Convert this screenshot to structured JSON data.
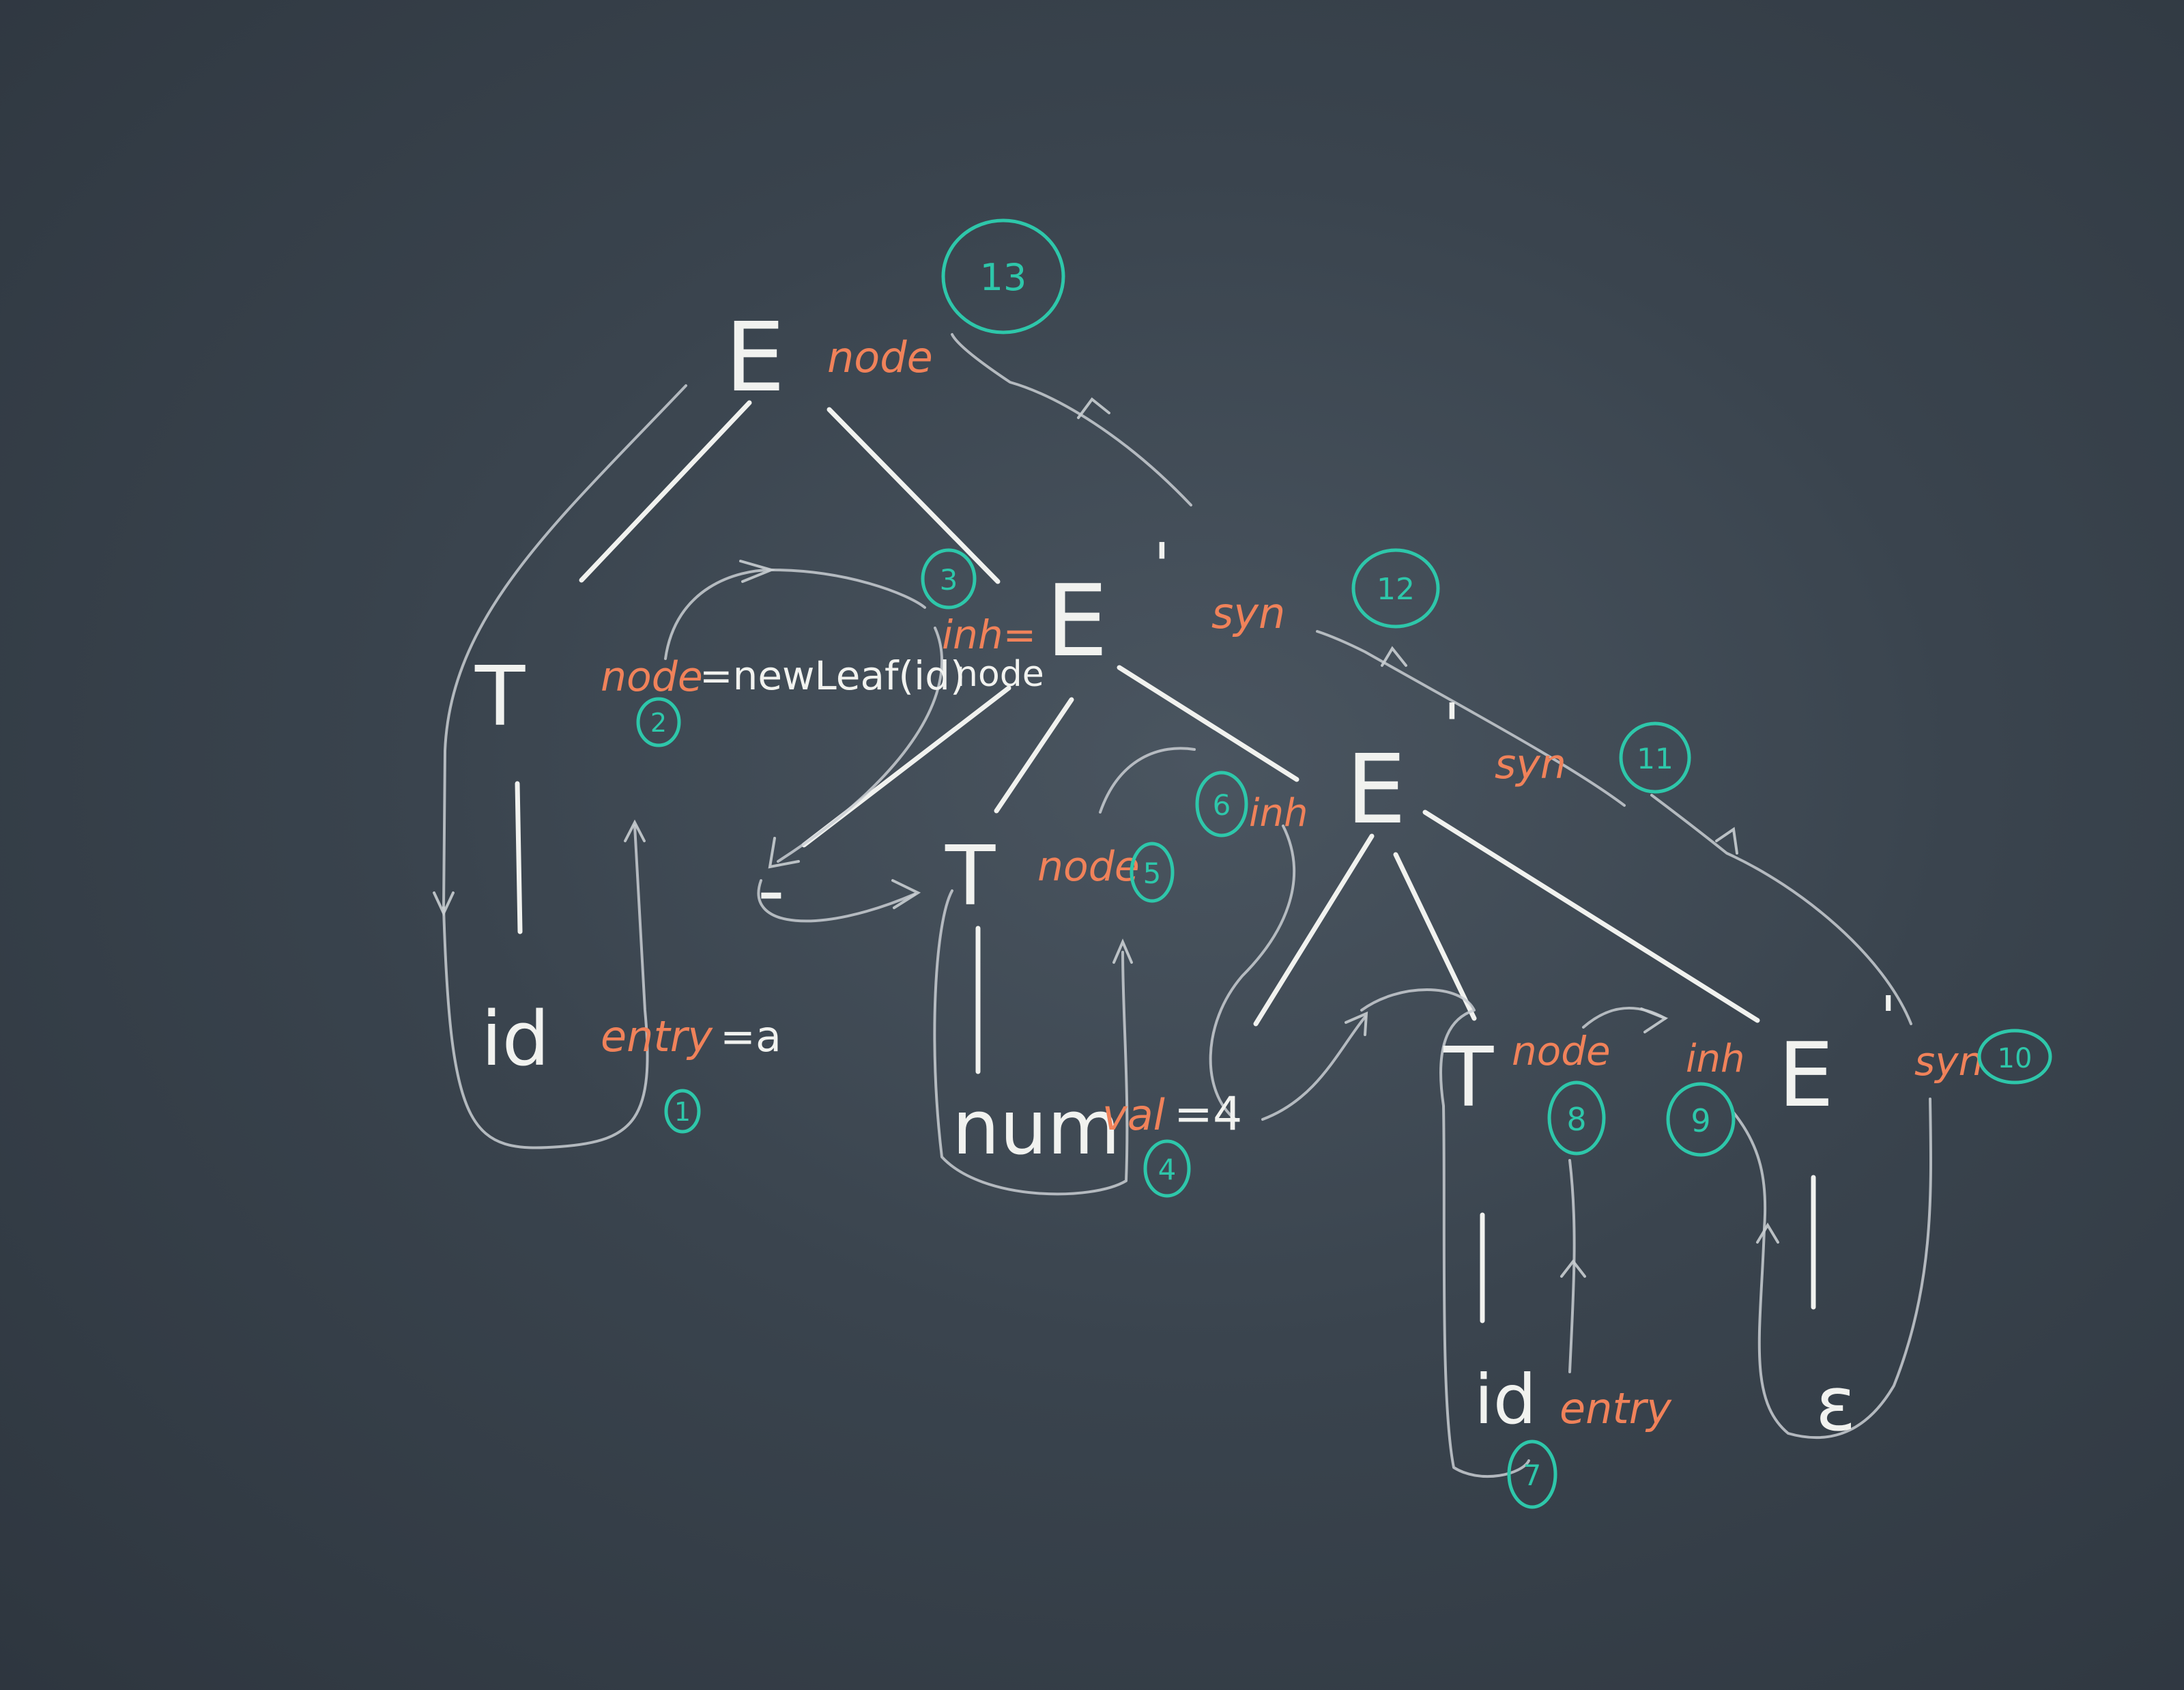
{
  "nodes": {
    "E_root": "E",
    "T_left": "T",
    "id_left": "id",
    "E_prime_1": "E",
    "minus": "-",
    "T_mid": "T",
    "num": "num",
    "E_prime_2": "E",
    "T_right": "T",
    "id_right": "id",
    "E_prime_3": "E",
    "epsilon": "ε"
  },
  "primes": {
    "p1": "'",
    "p2": "'",
    "p3": "'"
  },
  "attributes": {
    "root_node": "node",
    "t_left_node": "node",
    "newleaf_call": "=newLeaf(id)",
    "id_left_entry": "entry",
    "id_left_value": "=a",
    "e1_inh": "inh=",
    "e1_inh_node": "node",
    "e1_syn": "syn",
    "t_mid_node": "node",
    "num_val": "val",
    "num_val_value": "=4",
    "e2_inh": "inh",
    "e2_syn": "syn",
    "t_right_node": "node",
    "e3_inh": "inh",
    "e3_syn": "syn",
    "id_right_entry": "entry"
  },
  "steps": {
    "s1": "1",
    "s2": "2",
    "s3": "3",
    "s4": "4",
    "s5": "5",
    "s6": "6",
    "s7": "7",
    "s8": "8",
    "s9": "9",
    "s10": "10",
    "s11": "11",
    "s12": "12",
    "s13": "13"
  },
  "colors": {
    "board": "#3a444e",
    "chalk_white": "#f1f2ef",
    "chalk_orange": "#f0825a",
    "chalk_teal": "#2ec7aa"
  }
}
